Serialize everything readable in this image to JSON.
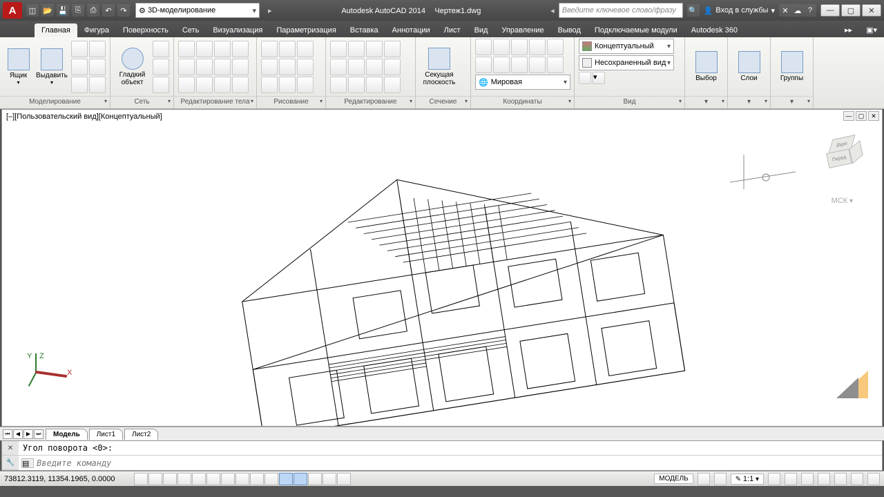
{
  "title": {
    "app": "Autodesk AutoCAD 2014",
    "doc": "Чертеж1.dwg"
  },
  "workspace": "3D-моделирование",
  "search_placeholder": "Введите ключевое слово/фразу",
  "account": "Вход в службы",
  "tabs": [
    "Главная",
    "Фигура",
    "Поверхность",
    "Сеть",
    "Визуализация",
    "Параметризация",
    "Вставка",
    "Аннотации",
    "Лист",
    "Вид",
    "Управление",
    "Вывод",
    "Подключаемые модули",
    "Autodesk 360"
  ],
  "active_tab": 0,
  "panels": {
    "modeling": {
      "title": "Моделирование",
      "box": "Ящик",
      "extrude": "Выдавить"
    },
    "mesh": {
      "title": "Сеть",
      "smooth": "Гладкий\nобъект"
    },
    "solid_edit": {
      "title": "Редактирование тела"
    },
    "draw": {
      "title": "Рисование"
    },
    "modify": {
      "title": "Редактирование"
    },
    "section": {
      "title": "Сечение",
      "plane": "Секущая\nплоскость"
    },
    "coords": {
      "title": "Координаты",
      "world": "Мировая"
    },
    "view": {
      "title": "Вид",
      "visual_style": "Концептуальный",
      "saved_view": "Несохраненный вид"
    },
    "select": {
      "title": "Выбор"
    },
    "layers": {
      "title": "Слои"
    },
    "groups": {
      "title": "Группы"
    }
  },
  "viewport": {
    "label": "[–][Пользовательский вид][Концептуальный]",
    "mck": "МСК",
    "cube": {
      "top": "Верх",
      "front": "Перед"
    }
  },
  "sheet_tabs": [
    "Модель",
    "Лист1",
    "Лист2"
  ],
  "cmd": {
    "history": "Угол поворота <0>:",
    "prompt_placeholder": "Введите команду"
  },
  "status": {
    "coords": "73812.3119, 11354.1965, 0.0000",
    "model": "МОДЕЛЬ",
    "scale": "1:1"
  }
}
